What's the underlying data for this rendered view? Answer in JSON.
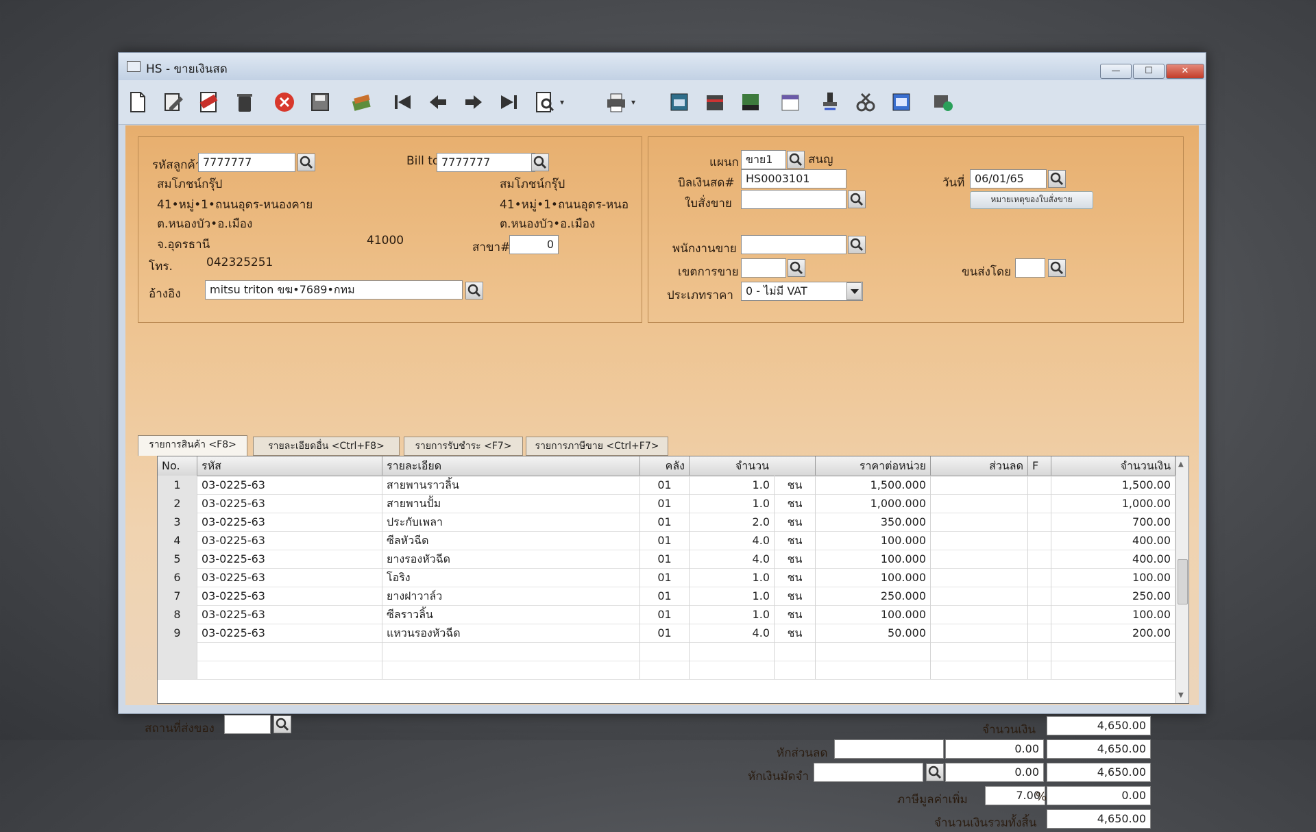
{
  "window": {
    "title": "HS - ขายเงินสด",
    "min": "—",
    "max": "☐",
    "close": "✕"
  },
  "toolbar": [
    "new-doc",
    "edit",
    "void",
    "delete",
    "cancel",
    "save",
    "copy",
    "first",
    "prev",
    "next",
    "last",
    "find",
    "print",
    "import",
    "export",
    "report",
    "calendar",
    "approve",
    "tools",
    "ok-doc",
    "network"
  ],
  "customer": {
    "code_label": "รหัสลูกค้า",
    "code": "7777777",
    "name": "สมโภชน์กรุ๊ป",
    "addr1": "41•หมู่•1•ถนนอุดร-หนองคาย",
    "addr2": "ต.หนองบัว•อ.เมือง",
    "addr3": "จ.อุดรธานี",
    "zip": "41000",
    "phone_label": "โทร.",
    "phone": "042325251",
    "ref_label": "อ้างอิง",
    "ref": "mitsu triton ขฆ•7689•กทม"
  },
  "billto": {
    "label": "Bill to",
    "code": "7777777",
    "name": "สมโภชน์กรุ๊ป",
    "addr1": "41•หมู่•1•ถนนอุดร-หนอ",
    "addr2": "ต.หนองบัว•อ.เมือง",
    "branch_label": "สาขา#",
    "branch": "0"
  },
  "doc": {
    "dept_label": "แผนก",
    "dept": "ขาย1",
    "dept_name": "สนญ",
    "bill_label": "บิลเงินสด#",
    "bill_no": "HS0003101",
    "date_label": "วันที่",
    "date": "06/01/65",
    "order_label": "ใบสั่งขาย",
    "order": "",
    "order_note_btn": "หมายเหตุของใบสั่งขาย",
    "salesman_label": "พนักงานขาย",
    "salesman": "",
    "area_label": "เขตการขาย",
    "area": "",
    "ship_by_label": "ขนส่งโดย",
    "ship_by": "",
    "price_type_label": "ประเภทราคา",
    "price_type": "0 - ไม่มี VAT"
  },
  "tabs": [
    "รายการสินค้า <F8>",
    "รายละเอียดอื่น <Ctrl+F8>",
    "รายการรับชำระ <F7>",
    "รายการภาษีขาย <Ctrl+F7>"
  ],
  "grid": {
    "headers": [
      "No.",
      "รหัส",
      "รายละเอียด",
      "คลัง",
      "จำนวน",
      "ราคาต่อหน่วย",
      "ส่วนลด",
      "F",
      "จำนวนเงิน"
    ],
    "rows": [
      {
        "no": "1",
        "code": "03-0225-63",
        "desc": "สายพานราวลิ้น",
        "wh": "01",
        "qty": "1.0",
        "unit": "ชน",
        "price": "1,500.000",
        "disc": "",
        "f": "",
        "amount": "1,500.00"
      },
      {
        "no": "2",
        "code": "03-0225-63",
        "desc": "สายพานปั้ม",
        "wh": "01",
        "qty": "1.0",
        "unit": "ชน",
        "price": "1,000.000",
        "disc": "",
        "f": "",
        "amount": "1,000.00"
      },
      {
        "no": "3",
        "code": "03-0225-63",
        "desc": "ประกับเพลา",
        "wh": "01",
        "qty": "2.0",
        "unit": "ชน",
        "price": "350.000",
        "disc": "",
        "f": "",
        "amount": "700.00"
      },
      {
        "no": "4",
        "code": "03-0225-63",
        "desc": "ซีลหัวฉีด",
        "wh": "01",
        "qty": "4.0",
        "unit": "ชน",
        "price": "100.000",
        "disc": "",
        "f": "",
        "amount": "400.00"
      },
      {
        "no": "5",
        "code": "03-0225-63",
        "desc": "ยางรองหัวฉีด",
        "wh": "01",
        "qty": "4.0",
        "unit": "ชน",
        "price": "100.000",
        "disc": "",
        "f": "",
        "amount": "400.00"
      },
      {
        "no": "6",
        "code": "03-0225-63",
        "desc": "โอริง",
        "wh": "01",
        "qty": "1.0",
        "unit": "ชน",
        "price": "100.000",
        "disc": "",
        "f": "",
        "amount": "100.00"
      },
      {
        "no": "7",
        "code": "03-0225-63",
        "desc": "ยางฝาวาล์ว",
        "wh": "01",
        "qty": "1.0",
        "unit": "ชน",
        "price": "250.000",
        "disc": "",
        "f": "",
        "amount": "250.00"
      },
      {
        "no": "8",
        "code": "03-0225-63",
        "desc": "ซีลราวลิ้น",
        "wh": "01",
        "qty": "1.0",
        "unit": "ชน",
        "price": "100.000",
        "disc": "",
        "f": "",
        "amount": "100.00"
      },
      {
        "no": "9",
        "code": "03-0225-63",
        "desc": "แหวนรองหัวฉีด",
        "wh": "01",
        "qty": "4.0",
        "unit": "ชน",
        "price": "50.000",
        "disc": "",
        "f": "",
        "amount": "200.00"
      }
    ]
  },
  "footer": {
    "ship_place_label": "สถานที่ส่งของ",
    "ship_place": "",
    "amount_label": "จำนวนเงิน",
    "amount": "4,650.00",
    "discount_label": "หักส่วนลด",
    "discount_text": "",
    "discount": "0.00",
    "after_discount": "4,650.00",
    "deposit_label": "หักเงินมัดจำ",
    "deposit_text": "",
    "deposit": "0.00",
    "after_deposit": "4,650.00",
    "vat_label": "ภาษีมูลค่าเพิ่ม",
    "vat_rate": "7.00",
    "vat_pct": "%",
    "vat_amount": "0.00",
    "total_label": "จำนวนเงินรวมทั้งสิ้น",
    "total": "4,650.00"
  }
}
